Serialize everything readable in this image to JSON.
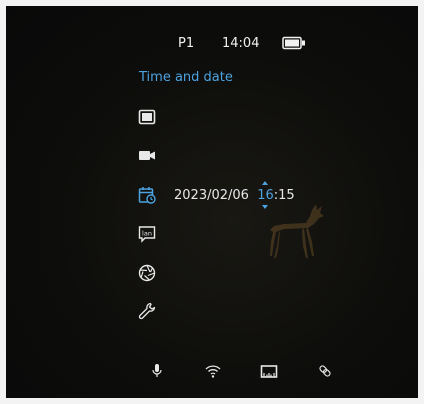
{
  "status": {
    "profile": "P1",
    "time": "14:04",
    "battery_icon": "battery-icon"
  },
  "menu": {
    "title": "Time and date",
    "items": [
      {
        "icon": "display-icon"
      },
      {
        "icon": "video-camera-icon"
      },
      {
        "icon": "calendar-clock-icon",
        "date": "2023/02/06",
        "hour": "16",
        "separator": ":",
        "minute": "15"
      },
      {
        "icon": "language-icon"
      },
      {
        "icon": "aperture-icon"
      },
      {
        "icon": "wrench-icon"
      }
    ]
  },
  "bottom_bar": [
    "microphone-icon",
    "wifi-icon",
    "ruler-icon",
    "link-icon"
  ],
  "colors": {
    "accent": "#4da3e0",
    "text": "#e8e8e8",
    "background": "#0d0d0b",
    "frame": "#f3f3f3"
  }
}
